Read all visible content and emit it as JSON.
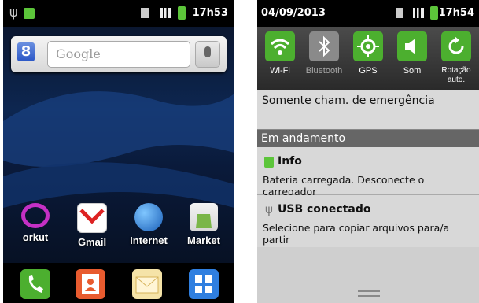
{
  "left_phone": {
    "status_time": "17h53",
    "search_placeholder": "Google",
    "apps": [
      "orkut",
      "Gmail",
      "Internet",
      "Market"
    ]
  },
  "right_phone": {
    "status_date": "04/09/2013",
    "status_time": "17h54",
    "toggles": [
      {
        "label": "Wi-Fi",
        "icon": "wifi-icon",
        "active": true
      },
      {
        "label": "Bluetooth",
        "icon": "bluetooth-icon",
        "active": false
      },
      {
        "label": "GPS",
        "icon": "gps-icon",
        "active": true
      },
      {
        "label": "Som",
        "icon": "sound-icon",
        "active": true
      },
      {
        "label": "Rotação auto.",
        "icon": "rotation-icon",
        "active": true
      }
    ],
    "emergency_text": "Somente cham. de emergência",
    "section_title": "Em andamento",
    "notifications": [
      {
        "title": "Info",
        "text": "Bateria carregada. Desconecte o carregador"
      },
      {
        "title": "USB conectado",
        "text": "Selecione para copiar arquivos para/a partir"
      }
    ]
  },
  "colors": {
    "toggle_active": "#4caf2f",
    "toggle_inactive": "#8a8a8a"
  }
}
